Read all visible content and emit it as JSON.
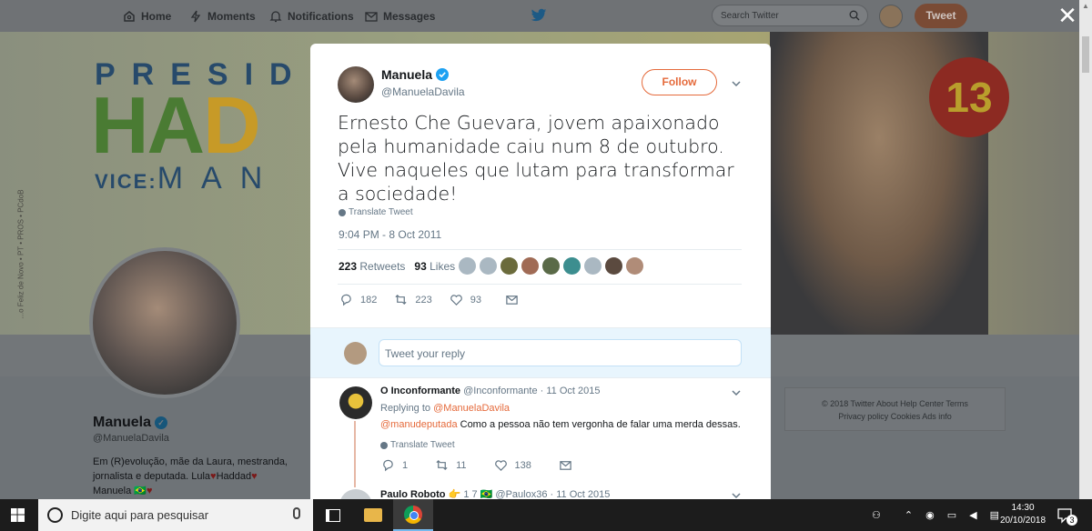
{
  "nav": {
    "home": "Home",
    "moments": "Moments",
    "notifications": "Notifications",
    "messages": "Messages",
    "search_placeholder": "Search Twitter",
    "tweet_button": "Tweet",
    "close": "✕"
  },
  "banner": {
    "line1": "PRESID",
    "line2a": "HA",
    "line2b": "D",
    "line2c": "",
    "vice_label": "VICE:",
    "vice_name": "MAN",
    "number": "13",
    "side_text": "...o Feliz de Novo • PT • PROS • PCdoB"
  },
  "profile": {
    "name": "Manuela",
    "handle": "@ManuelaDavila",
    "bio_1": "Em (R)evolução, mãe da Laura, mestranda,",
    "bio_2": "jornalista e deputada. Lula",
    "bio_heart": "♥",
    "bio_3": "Haddad",
    "bio_4": "Manuela 🇧🇷",
    "footer_line1": "© 2018 Twitter   About   Help Center   Terms",
    "footer_line2": "Privacy policy   Cookies   Ads info"
  },
  "tweet": {
    "author_name": "Manuela",
    "author_handle": "@ManuelaDavila",
    "follow_label": "Follow",
    "text": "Ernesto Che Guevara, jovem apaixonado pela humanidade caiu num 8 de outubro. Vive naqueles que lutam para transformar a sociedade!",
    "translate": "Translate Tweet",
    "timestamp": "9:04 PM - 8 Oct 2011",
    "retweets_count": "223",
    "retweets_label": "Retweets",
    "likes_count": "93",
    "likes_label": "Likes",
    "action_replies": "182",
    "action_retweets": "223",
    "action_likes": "93",
    "reply_placeholder": "Tweet your reply"
  },
  "replies": [
    {
      "name": "O Inconformante",
      "handle": "@Inconformante",
      "date": "· 11 Oct 2015",
      "replying_to_label": "Replying to",
      "replying_to": "@ManuelaDavila",
      "mention": "@manudeputada",
      "text": "Como a pessoa não tem vergonha de falar uma merda dessas.",
      "translate": "Translate Tweet",
      "replies": "1",
      "retweets": "11",
      "likes": "138"
    },
    {
      "name": "Paulo Roboto",
      "badges": "👉 1 7 🇧🇷",
      "handle": "@Paulox36",
      "date": "· 11 Oct 2015"
    }
  ],
  "taskbar": {
    "search_text": "Digite aqui para pesquisar",
    "time": "14:30",
    "date": "20/10/2018",
    "notification_count": "3"
  },
  "colors": {
    "accent": "#e56a3b",
    "secondary_text": "#657786",
    "modal_bg": "#ffffff"
  }
}
